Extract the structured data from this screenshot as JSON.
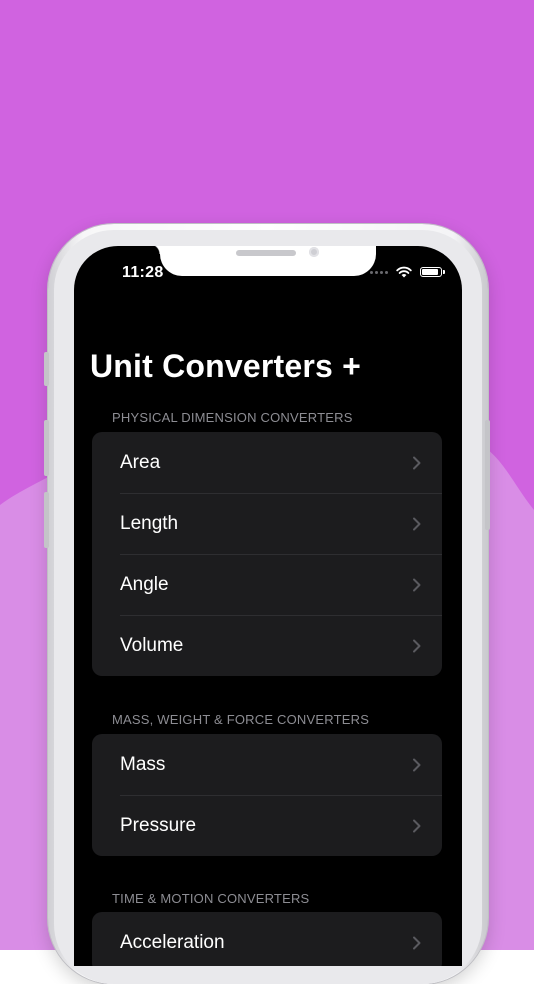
{
  "status_bar": {
    "time": "11:28"
  },
  "app": {
    "title": "Unit Converters +"
  },
  "sections": [
    {
      "header": "PHYSICAL DIMENSION CONVERTERS",
      "items": [
        {
          "label": "Area"
        },
        {
          "label": "Length"
        },
        {
          "label": "Angle"
        },
        {
          "label": "Volume"
        }
      ]
    },
    {
      "header": "MASS, WEIGHT & FORCE CONVERTERS",
      "items": [
        {
          "label": "Mass"
        },
        {
          "label": "Pressure"
        }
      ]
    },
    {
      "header": "TIME & MOTION CONVERTERS",
      "items": [
        {
          "label": "Acceleration"
        }
      ]
    }
  ],
  "colors": {
    "background_top": "#d063e0",
    "background_bottom": "#d98de6",
    "screen": "#000000",
    "row_background": "#1c1c1e",
    "section_header": "#8d8d93"
  },
  "icons": {
    "chevron": "chevron-right-icon",
    "wifi": "wifi-icon",
    "battery": "battery-icon",
    "signal": "cellular-signal-icon"
  }
}
